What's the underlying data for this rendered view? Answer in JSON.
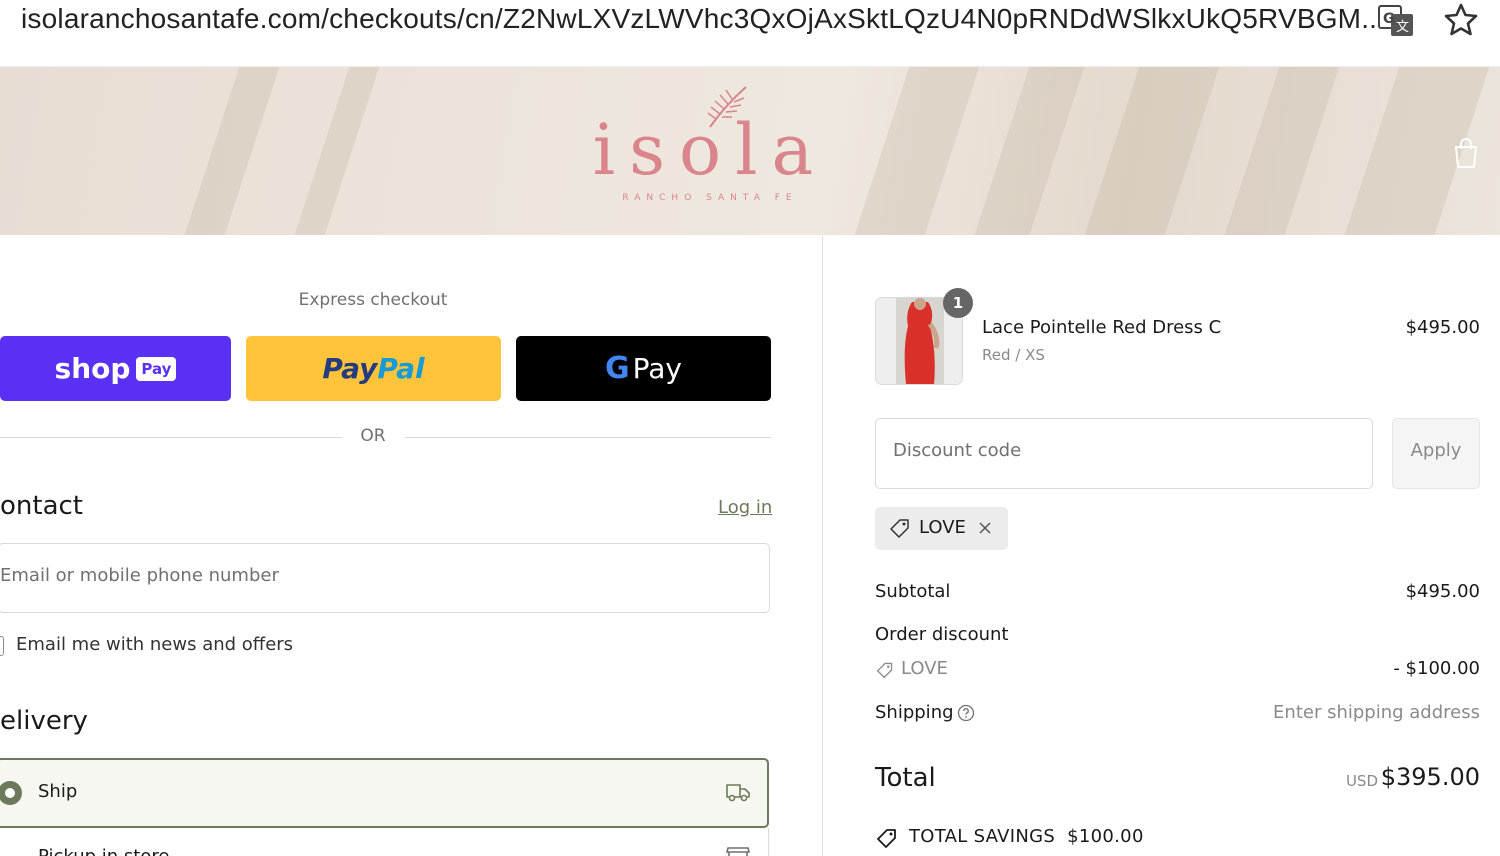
{
  "browser": {
    "url": "isolaranchosantafe.com/checkouts/cn/Z2NwLXVzLWVhc3QxOjAxSktLQzU4N0pRNDdWSlkxUkQ5RVBGM..."
  },
  "brand": {
    "logo_text": "isola",
    "logo_subtext": "RANCHO SANTA FE"
  },
  "express": {
    "label": "Express checkout",
    "shop_word": "shop",
    "shop_pay_badge": "Pay",
    "paypal_word_1": "Pay",
    "paypal_word_2": "Pal",
    "gpay_g": "G",
    "gpay_word": "Pay",
    "or_text": "OR"
  },
  "contact": {
    "title": "ontact",
    "login_link": "Log in",
    "email_placeholder": "Email or mobile phone number",
    "newsletter_label": "Email me with news and offers"
  },
  "delivery": {
    "title": "elivery",
    "options": [
      {
        "label": "Ship",
        "selected": true
      },
      {
        "label": "Pickup in store",
        "selected": false
      }
    ]
  },
  "order": {
    "item": {
      "name": "Lace Pointelle Red Dress C",
      "variant": "Red / XS",
      "price": "$495.00",
      "quantity": "1"
    },
    "discount_placeholder": "Discount code",
    "apply_label": "Apply",
    "applied_code": "LOVE",
    "subtotal_label": "Subtotal",
    "subtotal_value": "$495.00",
    "order_discount_label": "Order discount",
    "discount_code": "LOVE",
    "discount_value": "- $100.00",
    "shipping_label": "Shipping",
    "shipping_value": "Enter shipping address",
    "total_label": "Total",
    "total_currency": "USD",
    "total_value": "$395.00",
    "savings_label": "TOTAL SAVINGS",
    "savings_value": "$100.00"
  },
  "colors": {
    "accent": "#6b7a5a",
    "shop_pay": "#5a31f4",
    "paypal": "#ffc439",
    "gpay": "#000000",
    "logo": "#d9858b"
  }
}
